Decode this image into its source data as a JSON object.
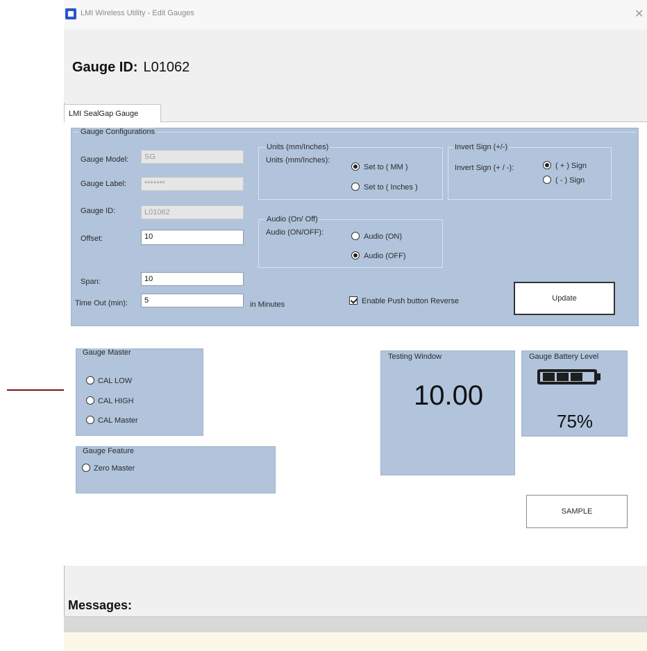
{
  "window": {
    "title": "LMI Wireless Utility - Edit Gauges",
    "close_glyph": "✕"
  },
  "header": {
    "gauge_id_label": "Gauge ID:",
    "gauge_id_value": "L01062"
  },
  "tab": {
    "label": "LMI SealGap Gauge"
  },
  "config": {
    "title": "Gauge Configurations",
    "model_label": "Gauge Model:",
    "model_value": "SG",
    "label_label": "Gauge Label:",
    "label_value": "*******",
    "id_label": "Gauge ID:",
    "id_value": "L01062",
    "offset_label": "Offset:",
    "offset_value": "10",
    "span_label": "Span:",
    "span_value": "10",
    "timeout_label": "Time Out (min):",
    "timeout_value": "5",
    "timeout_unit": "in Minutes",
    "units_group": "Units (mm/Inches)",
    "units_label": "Units (mm/Inches):",
    "units_mm": "Set to ( MM )",
    "units_inches": "Set to ( Inches )",
    "invert_group": "Invert Sign (+/-)",
    "invert_label": "Invert Sign (+ / -):",
    "invert_plus": "( + ) Sign",
    "invert_minus": "( - ) Sign",
    "audio_group": "Audio (On/ Off)",
    "audio_label": "Audio (ON/OFF):",
    "audio_on": "Audio (ON)",
    "audio_off": "Audio (OFF)",
    "push_reverse": "Enable Push button Reverse",
    "update_button": "Update"
  },
  "gauge_master": {
    "title": "Gauge Master",
    "options": [
      "CAL LOW",
      "CAL HIGH",
      "CAL Master"
    ]
  },
  "gauge_feature": {
    "title": "Gauge Feature",
    "option": "Zero Master"
  },
  "testing_window": {
    "title": "Testing Window",
    "value": "10.00"
  },
  "battery": {
    "title": "Gauge Battery Level",
    "percent": "75%",
    "level": 0.75
  },
  "sample_button": "SAMPLE",
  "messages_label": "Messages:",
  "colors": {
    "panel": "#b1c4dc",
    "arrow": "#7a1010",
    "app_icon": "#2a56c6"
  },
  "icons": {
    "app": "app-icon",
    "close": "close-icon",
    "arrow": "arrow-right-icon",
    "battery": "battery-icon"
  }
}
